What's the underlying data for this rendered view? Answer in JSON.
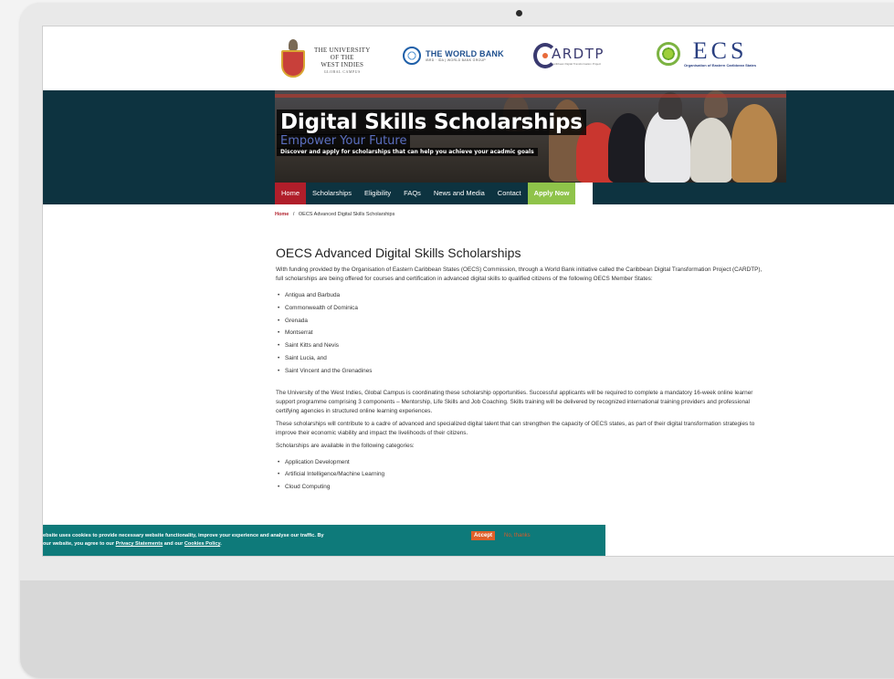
{
  "logos": {
    "uwi": {
      "line1": "THE UNIVERSITY",
      "line2": "OF THE",
      "line3": "WEST INDIES",
      "line4": "GLOBAL CAMPUS"
    },
    "worldbank": {
      "title": "THE WORLD BANK",
      "sub": "IBRD · IDA | WORLD BANK GROUP"
    },
    "cardtp": {
      "title": "ARDTP",
      "sub": "Caribbean Digital Transformation Project"
    },
    "oecs": {
      "title": "ECS",
      "sub": "Organisation of Eastern Caribbean States"
    }
  },
  "banner": {
    "title": "Digital Skills Scholarships",
    "empower": "Empower Your Future",
    "discover": "Discover and apply for scholarships that can help you achieve your acadmic goals"
  },
  "nav": {
    "home": "Home",
    "scholarships": "Scholarships",
    "eligibility": "Eligibility",
    "faqs": "FAQs",
    "news": "News and Media",
    "contact": "Contact",
    "apply": "Apply Now"
  },
  "breadcrumb": {
    "home": "Home",
    "separator": "/",
    "current": "OECS Advanced Digital Skills Scholarships"
  },
  "main": {
    "title": "OECS Advanced Digital Skills Scholarships",
    "intro": "With funding provided by the Organisation of Eastern Caribbean States (OECS) Commission, through a World Bank initiative called the Caribbean Digital Transformation Project (CARDTP), full scholarships are being offered for courses and certification in advanced digital skills to qualified citizens of the following OECS Member States:",
    "states": [
      "Antigua and Barbuda",
      "Commonwealth of Dominica",
      "Grenada",
      "Montserrat",
      "Saint Kitts and Nevis",
      "Saint Lucia, and",
      "Saint Vincent and the Grenadines"
    ],
    "para2": "The University of the West Indies, Global Campus is coordinating these scholarship opportunities.  Successful applicants will be required to complete a mandatory 16-week online learner support programme comprising 3 components – Mentorship, Life Skills and Job Coaching. Skills training will be delivered by recognized international training providers and professional certifying agencies in structured online learning experiences.",
    "para3": "These scholarships will contribute to a cadre of advanced and specialized digital talent that can strengthen the capacity of OECS states, as part of their digital transformation strategies to improve their economic viability and impact the livelihoods of their citizens.",
    "para4": "Scholarships are available in the following categories:",
    "categories": [
      "Application Development",
      "Artificial Intelligence/Machine Learning",
      "Cloud Computing"
    ]
  },
  "cookie": {
    "line1": "ebsite uses cookies to provide necessary website functionality, improve your experience and analyse our traffic. By",
    "line2_pre": "our website, you agree to our",
    "privacy": "Privacy Statements",
    "and": "and our",
    "cookies_policy": "Cookies Policy",
    "accept": "Accept",
    "no_thanks": "No, thanks"
  },
  "colors": {
    "nav_bg": "#0d3340",
    "home_active": "#b01e2a",
    "apply_btn": "#8fc34a",
    "cookie_bg": "#0e7a7a",
    "accept_btn": "#e0602a"
  }
}
